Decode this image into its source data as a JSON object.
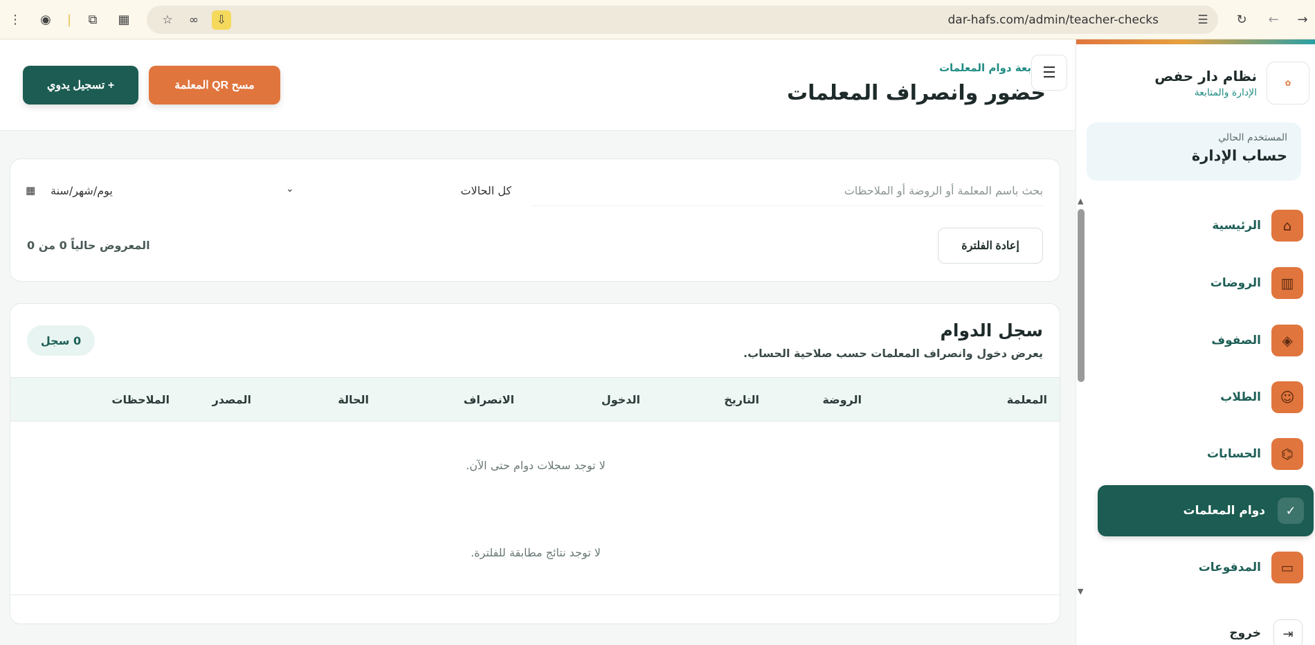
{
  "browser": {
    "url": "dar-hafs.com/admin/teacher-checks"
  },
  "sidebar": {
    "brand_title": "نظام دار حفص",
    "brand_subtitle": "الإدارة والمتابعة",
    "user_label": "المستخدم الحالي",
    "user_name": "حساب الإدارة",
    "items": [
      {
        "label": "الرئيسية",
        "icon": "home-icon"
      },
      {
        "label": "الروضات",
        "icon": "building-icon"
      },
      {
        "label": "الصفوف",
        "icon": "layers-icon"
      },
      {
        "label": "الطلاب",
        "icon": "users-icon"
      },
      {
        "label": "الحسابات",
        "icon": "graduation-cap-icon"
      },
      {
        "label": "دوام المعلمات",
        "icon": "check-circle-icon",
        "active": true
      },
      {
        "label": "المدفوعات",
        "icon": "credit-card-icon"
      }
    ],
    "logout_label": "خروج"
  },
  "header": {
    "eyebrow": "متابعة دوام المعلمات",
    "title": "حضور وانصراف المعلمات",
    "qr_button": "مسح QR المعلمة",
    "manual_button": "+ تسجيل يدوي"
  },
  "filters": {
    "search_placeholder": "بحث باسم المعلمة أو الروضة أو الملاحظات",
    "status_value": "كل الحالات",
    "date_placeholder": "يوم/شهر/سنة",
    "reset_button": "إعادة الفلترة",
    "shown_text": "المعروض حالياً 0 من 0"
  },
  "records": {
    "title": "سجل الدوام",
    "subtitle": "يعرض دخول وانصراف المعلمات حسب صلاحية الحساب.",
    "count_badge": "0 سجل",
    "columns": [
      "المعلمة",
      "الروضة",
      "التاريخ",
      "الدخول",
      "الانصراف",
      "الحالة",
      "المصدر",
      "الملاحظات"
    ],
    "empty_message": "لا توجد سجلات دوام حتى الآن.",
    "no_match_message": "لا توجد نتائج مطابقة للفلترة."
  },
  "colors": {
    "primary": "#1c5c52",
    "accent": "#e0753d",
    "teal_text": "#1f8c83"
  }
}
